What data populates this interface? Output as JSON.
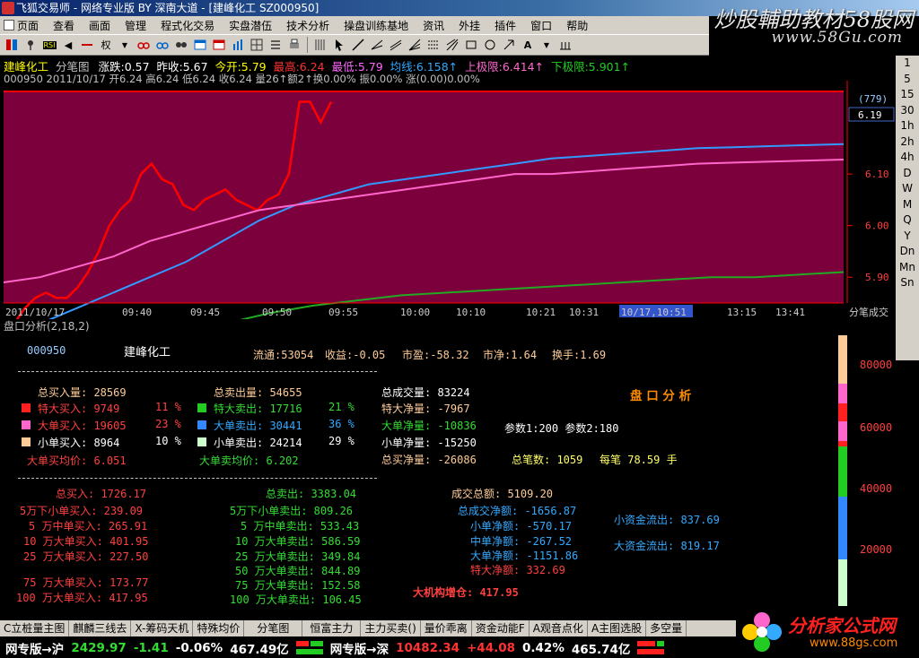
{
  "window": {
    "title": "飞狐交易师 - 网络专业版 BY 深南大道 - [建峰化工 SZ000950]"
  },
  "watermark": {
    "line1": "炒股輔助教材58股网",
    "line2": "www.58Gu.com"
  },
  "menu": [
    "页面",
    "查看",
    "画面",
    "管理",
    "程式化交易",
    "实盘潜伍",
    "技术分析",
    "操盘训练基地",
    "资讯",
    "外挂",
    "插件",
    "窗口",
    "帮助"
  ],
  "toolbar": {
    "rsi": "RSI",
    "quan": "权"
  },
  "periods": [
    "1",
    "5",
    "15",
    "30",
    "1h",
    "2h",
    "4h",
    "D",
    "W",
    "M",
    "Q",
    "Y",
    "Dn",
    "Mn",
    "Sn"
  ],
  "info1": {
    "name": "建峰化工",
    "mode": "分笔图",
    "change": "涨跌:0.57",
    "prevclose": "昨收:5.67",
    "open": "今开:5.79",
    "high": "最高:6.24",
    "low": "最低:5.79",
    "avgline": "均线:6.158↑",
    "uplimit": "上极限:6.414↑",
    "downlimit": "下极限:5.901↑"
  },
  "info2": "000950 2011/10/17 开6.24 高6.24 低6.24 收6.24 量26↑额2↑换0.00% 振0.00% 涨(0.00)0.00%",
  "chart_data": {
    "type": "line",
    "x_ticks": [
      "2011/10/17",
      "09:40",
      "09:45",
      "09:50",
      "09:55",
      "10:00",
      "10:10",
      "10:21",
      "10:31",
      "10/17,10:51",
      "13:15",
      "13:41"
    ],
    "y_ticks": [
      6.19,
      6.1,
      6.0,
      5.9
    ],
    "y_badge": "(779)",
    "ylim": [
      5.85,
      6.26
    ],
    "colors": {
      "background": "#7c003c",
      "price": "#ff0000",
      "avg": "#3399ff",
      "upper": "#ff66cc",
      "lower": "#22aa22"
    },
    "series": [
      {
        "key": "price",
        "values": [
          5.79,
          5.81,
          5.84,
          5.86,
          5.87,
          5.86,
          5.86,
          5.88,
          5.91,
          5.95,
          6.0,
          6.03,
          6.05,
          6.1,
          6.12,
          6.09,
          6.08,
          6.04,
          6.03,
          6.05,
          6.06,
          6.07,
          6.05,
          6.04,
          6.03,
          6.05,
          6.06,
          6.1,
          6.24,
          6.24,
          6.2,
          6.24
        ]
      },
      {
        "key": "avg",
        "values": [
          5.8,
          5.81,
          5.84,
          5.87,
          5.9,
          5.93,
          5.97,
          6.01,
          6.04,
          6.06,
          6.08,
          6.09,
          6.1,
          6.11,
          6.12,
          6.13,
          6.135,
          6.14,
          6.145,
          6.15,
          6.152,
          6.154,
          6.156,
          6.158
        ]
      },
      {
        "key": "upper",
        "values": [
          5.89,
          5.9,
          5.92,
          5.94,
          5.97,
          5.99,
          6.01,
          6.03,
          6.04,
          6.05,
          6.06,
          6.07,
          6.08,
          6.09,
          6.1,
          6.1,
          6.105,
          6.11,
          6.115,
          6.12,
          6.122,
          6.124,
          6.126,
          6.128
        ]
      },
      {
        "key": "lower",
        "values": [
          5.5,
          5.6,
          5.7,
          5.75,
          5.79,
          5.81,
          5.83,
          5.845,
          5.855,
          5.865,
          5.87,
          5.875,
          5.88,
          5.885,
          5.89,
          5.895,
          5.9,
          5.9,
          5.905,
          5.91
        ]
      }
    ]
  },
  "axis": {
    "label": "分笔成交",
    "price_box": "6.19"
  },
  "panel": {
    "label": "盘口分析(2,18,2)",
    "code": "000950",
    "name": "建峰化工",
    "liutong": "流通:53054",
    "shouyi": "收益:-0.05",
    "shiying": "市盈:-58.32",
    "shijing": "市净:1.64",
    "huanshou": "换手:1.69",
    "title": "盘 口 分 析",
    "buy": {
      "total": "总买入量: 28569",
      "rows": [
        {
          "label": "特大买入: 9749",
          "pct": "11 %",
          "color": "#ff2020"
        },
        {
          "label": "大单买入: 19605",
          "pct": "23 %",
          "color": "#ff66cc"
        },
        {
          "label": "小单买入: 8964",
          "pct": "10 %",
          "color": "#ffcc99"
        }
      ],
      "avg": "大单买均价: 6.051"
    },
    "sell": {
      "total": "总卖出量: 54655",
      "rows": [
        {
          "label": "特大卖出: 17716",
          "pct": "21 %",
          "color": "#22cc22"
        },
        {
          "label": "大单卖出: 30441",
          "pct": "36 %",
          "color": "#3388ff"
        },
        {
          "label": "小单卖出: 24214",
          "pct": "29 %",
          "color": "#ccffcc"
        }
      ],
      "avg": "大单卖均价: 6.202"
    },
    "net": {
      "vol": "总成交量: 83224",
      "rows": [
        "特大净量: -7967",
        "大单净量: -10836",
        "小单净量: -15250",
        "总买净量: -26086"
      ]
    },
    "params": "参数1:200  参数2:180",
    "stats": {
      "bishu": "总笔数: 1059",
      "meibi": "每笔  78.59  手"
    },
    "buy2": {
      "total": "总买入: 1726.17",
      "rows": [
        "5万下小单买入: 239.09",
        "5 万中单买入: 265.91",
        "10 万大单买入: 401.95",
        "25 万大单买入: 227.50",
        "75 万大单买入: 173.77",
        "100 万大单买入: 417.95"
      ]
    },
    "sell2": {
      "total": "总卖出: 3383.04",
      "rows": [
        "5万下小单卖出: 809.26",
        "5 万中单卖出: 533.43",
        "10 万大单卖出: 586.59",
        "25 万大单卖出: 349.84",
        "50 万大单卖出: 844.89",
        "75 万大单卖出: 152.58",
        "100 万大单卖出: 106.45"
      ]
    },
    "amount": {
      "total": "成交总额: 5109.20",
      "rows": [
        "总成交净额: -1656.87",
        "小单净额: -570.17",
        "中单净额: -267.52",
        "大单净额: -1151.86",
        "特大净额: 332.69"
      ],
      "inst": "大机构增仓: 417.95"
    },
    "flow": {
      "small": "小资金流出: 837.69",
      "big": "大资金流出: 819.17"
    },
    "scale": [
      "80000",
      "60000",
      "40000",
      "20000"
    ]
  },
  "tabs": [
    "C立桩量主图",
    "麒麟三线去",
    "X-筹码天机",
    "特殊均价",
    "分笔图",
    "恒富主力",
    "主力买卖()",
    "量价乖离",
    "资金动能F",
    "A观音点化",
    "A主图选股",
    "多空量"
  ],
  "status": {
    "sh_label": "网专版→沪",
    "sh_index": "2429.97",
    "sh_chg": "-1.41",
    "sh_pct": "-0.06%",
    "sh_amt": "467.49亿",
    "sz_label": "网专版→深",
    "sz_index": "10482.34",
    "sz_chg": "+44.08",
    "sz_pct": "0.42%",
    "sz_amt": "465.74亿"
  },
  "footer": {
    "name": "分析家公式网",
    "url": "www.88gs.com"
  }
}
